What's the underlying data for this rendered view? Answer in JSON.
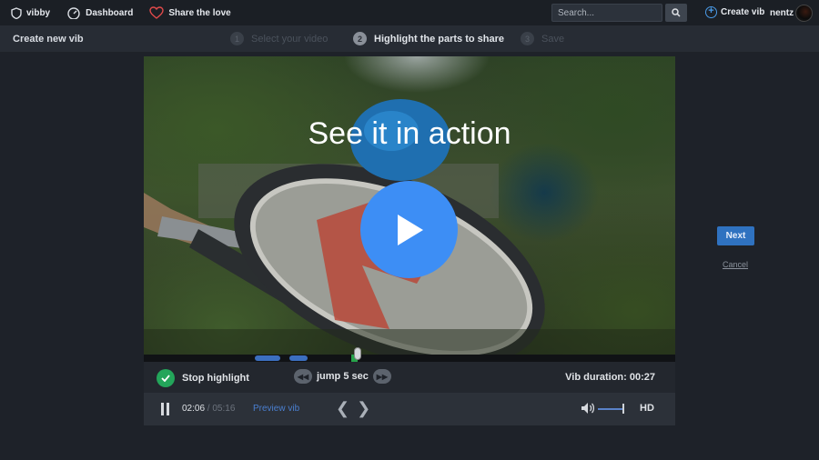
{
  "topnav": {
    "logo_label": "vibby",
    "dashboard_label": "Dashboard",
    "share_label": "Share the love",
    "search_placeholder": "Search...",
    "create_vib_label": "Create vib",
    "username": "nentz"
  },
  "subheader": {
    "title": "Create new vib",
    "steps": [
      {
        "num": "1",
        "label": "Select your video",
        "state": "inactive"
      },
      {
        "num": "2",
        "label": "Highlight the parts to share",
        "state": "active"
      },
      {
        "num": "3",
        "label": "Save",
        "state": "inactive"
      }
    ]
  },
  "video": {
    "heading": "See it in action"
  },
  "highlight": {
    "stop_label": "Stop highlight",
    "jump_label": "jump 5 sec",
    "vib_duration_label": "Vib duration: 00:27"
  },
  "controls": {
    "current_time": "02:06",
    "separator": " / ",
    "total_time": "05:16",
    "preview_label": "Preview vib",
    "hd_label": "HD",
    "volume_level": 1.0
  },
  "actions": {
    "next_label": "Next",
    "cancel_label": "Cancel"
  },
  "colors": {
    "accent_blue": "#3d8ef5",
    "success_green": "#23a55a",
    "background": "#1e2229"
  }
}
